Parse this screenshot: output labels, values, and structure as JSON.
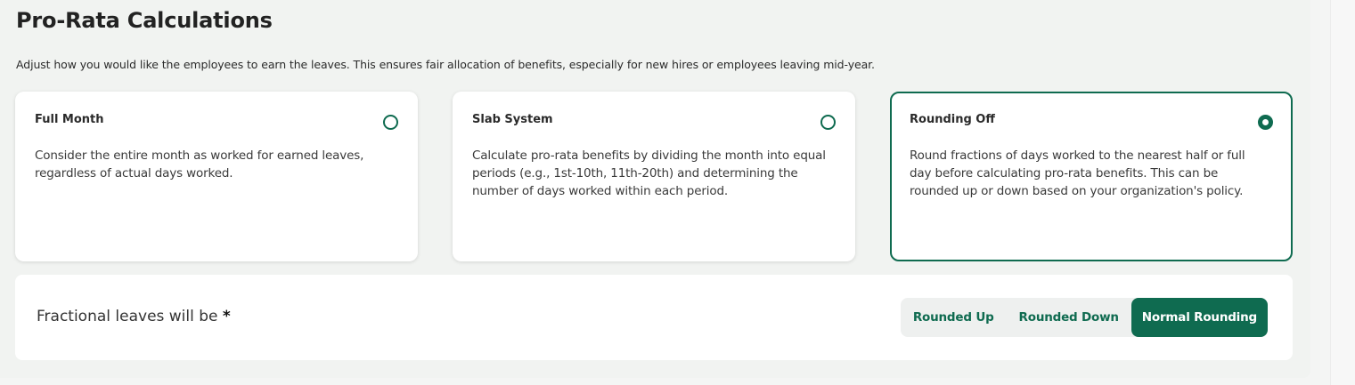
{
  "section": {
    "title": "Pro-Rata Calculations",
    "description": "Adjust how you would like the employees to earn the leaves. This ensures fair allocation of benefits, especially for new hires or employees leaving mid-year."
  },
  "options": [
    {
      "title": "Full Month",
      "description": "Consider the entire month as worked for earned leaves, regardless of actual days worked.",
      "selected": false
    },
    {
      "title": "Slab System",
      "description": "Calculate pro-rata benefits by dividing the month into equal periods (e.g., 1st-10th, 11th-20th) and determining the number of days worked within each period.",
      "selected": false
    },
    {
      "title": "Rounding Off",
      "description": "Round fractions of days worked to the nearest half or full day before calculating pro-rata benefits. This can be rounded up or down based on your organization's policy.",
      "selected": true
    }
  ],
  "fractional": {
    "label": "Fractional leaves will be",
    "required_mark": "*",
    "choices": [
      "Rounded Up",
      "Rounded Down",
      "Normal Rounding"
    ],
    "selected": "Normal Rounding"
  },
  "colors": {
    "accent": "#0f6b50",
    "panel_bg": "#f1f3f1",
    "card_bg": "#ffffff"
  }
}
